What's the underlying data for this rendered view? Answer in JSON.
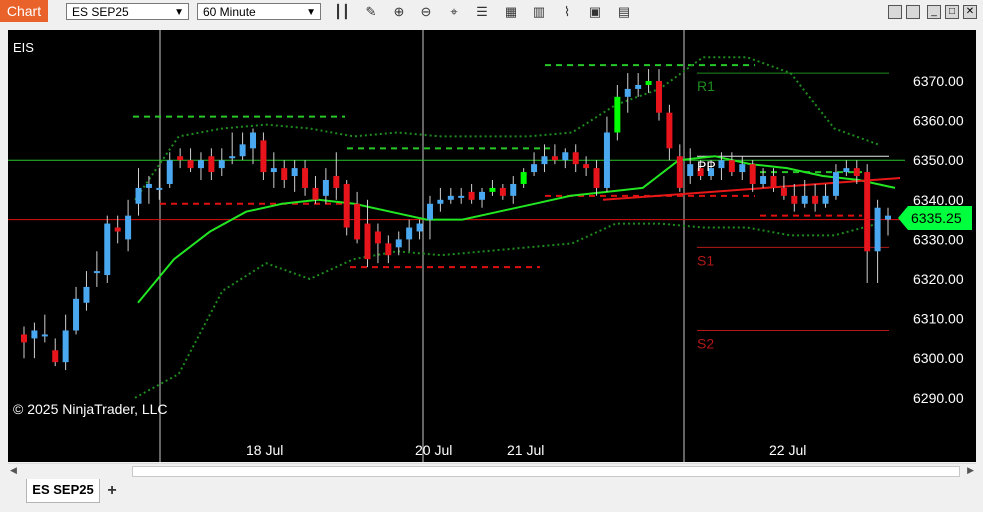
{
  "header": {
    "chart_tab": "Chart",
    "instrument_value": "ES SEP25",
    "interval_value": "60 Minute",
    "tools": [
      "bar-type-icon",
      "pencil-icon",
      "zoom-in-icon",
      "zoom-out-icon",
      "crosshair-icon",
      "properties-icon",
      "data-box-icon",
      "indicators-icon",
      "strategies-icon",
      "share-icon",
      "templates-icon"
    ],
    "window_buttons": [
      "minimize",
      "maximize",
      "close"
    ]
  },
  "chart": {
    "instrument_label": "EIS",
    "copyright": "© 2025 NinjaTrader, LLC",
    "current_price": "6335.25",
    "y_ticks": [
      "6370.00",
      "6360.00",
      "6350.00",
      "6340.00",
      "6330.00",
      "6320.00",
      "6310.00",
      "6300.00",
      "6290.00"
    ],
    "x_ticks": [
      "18 Jul",
      "20 Jul",
      "21 Jul",
      "22 Jul"
    ],
    "pivot_labels": {
      "r1": "R1",
      "pp": "PP",
      "s1": "S1",
      "s2": "S2"
    },
    "colors": {
      "up": "#4aa8f0",
      "down": "#e8141c",
      "up_green": "#00ff00",
      "pivot_green": "#1e8c1e",
      "pivot_red": "#b41818",
      "ma": "#22e622",
      "band": "#1e8c1e"
    }
  },
  "footer": {
    "tab_label": "ES SEP25",
    "add_tab": "+"
  },
  "chart_data": {
    "type": "candlestick",
    "y_ticks": [
      6290,
      6300,
      6310,
      6320,
      6330,
      6340,
      6350,
      6360,
      6370
    ],
    "ylim": [
      6286,
      6376
    ],
    "x_labels": [
      "18 Jul",
      "20 Jul",
      "21 Jul",
      "22 Jul"
    ],
    "last_price": 6335.25,
    "levels": {
      "R1": 6372,
      "PP": 6351,
      "S1": 6328,
      "S2": 6307
    },
    "candles": [
      [
        6306,
        6304,
        6308,
        6300
      ],
      [
        6305,
        6307,
        6309,
        6300
      ],
      [
        6306,
        6306,
        6311,
        6304
      ],
      [
        6302,
        6299,
        6305,
        6298
      ],
      [
        6299,
        6307,
        6311,
        6297
      ],
      [
        6307,
        6315,
        6318,
        6306
      ],
      [
        6314,
        6318,
        6322,
        6312
      ],
      [
        6322,
        6322,
        6327,
        6318
      ],
      [
        6321,
        6334,
        6336,
        6319
      ],
      [
        6333,
        6332,
        6336,
        6329
      ],
      [
        6330,
        6336,
        6340,
        6327
      ],
      [
        6339,
        6343,
        6348,
        6336
      ],
      [
        6343,
        6344,
        6346,
        6339
      ],
      [
        6343,
        6343,
        6348,
        6340
      ],
      [
        6344,
        6350,
        6352,
        6343
      ],
      [
        6351,
        6350,
        6353,
        6348
      ],
      [
        6350,
        6348,
        6353,
        6347
      ],
      [
        6348,
        6350,
        6352,
        6345
      ],
      [
        6351,
        6347,
        6353,
        6345
      ],
      [
        6348,
        6350,
        6353,
        6346
      ],
      [
        6351,
        6351,
        6357,
        6349
      ],
      [
        6351,
        6354,
        6357,
        6350
      ],
      [
        6353,
        6357,
        6358,
        6349
      ],
      [
        6355,
        6347,
        6357,
        6345
      ],
      [
        6347,
        6348,
        6352,
        6343
      ],
      [
        6348,
        6345,
        6350,
        6343
      ],
      [
        6346,
        6348,
        6350,
        6342
      ],
      [
        6348,
        6343,
        6350,
        6341
      ],
      [
        6343,
        6340,
        6346,
        6339
      ],
      [
        6341,
        6345,
        6348,
        6339
      ],
      [
        6346,
        6343,
        6352,
        6340
      ],
      [
        6344,
        6333,
        6345,
        6331
      ],
      [
        6339,
        6330,
        6342,
        6329
      ],
      [
        6334,
        6325,
        6340,
        6323
      ],
      [
        6332,
        6329,
        6334,
        6324
      ],
      [
        6329,
        6326,
        6331,
        6324
      ],
      [
        6328,
        6330,
        6332,
        6326
      ],
      [
        6330,
        6333,
        6335,
        6327
      ],
      [
        6332,
        6334,
        6335,
        6330
      ],
      [
        6335,
        6339,
        6341,
        6330
      ],
      [
        6339,
        6340,
        6343,
        6337
      ],
      [
        6340,
        6341,
        6343,
        6339
      ],
      [
        6341,
        6341,
        6343,
        6339
      ],
      [
        6342,
        6340,
        6344,
        6339
      ],
      [
        6340,
        6342,
        6343,
        6338
      ],
      [
        6342,
        6343,
        6345,
        6341
      ],
      [
        6343,
        6341,
        6344,
        6340
      ],
      [
        6341,
        6344,
        6346,
        6339
      ],
      [
        6344,
        6347,
        6348,
        6343
      ],
      [
        6347,
        6349,
        6352,
        6346
      ],
      [
        6349,
        6351,
        6354,
        6347
      ],
      [
        6351,
        6350,
        6354,
        6349
      ],
      [
        6350,
        6352,
        6353,
        6348
      ],
      [
        6352,
        6349,
        6354,
        6347
      ],
      [
        6349,
        6348,
        6351,
        6346
      ],
      [
        6348,
        6343,
        6350,
        6341
      ],
      [
        6343,
        6357,
        6361,
        6342
      ],
      [
        6357,
        6366,
        6369,
        6355
      ],
      [
        6366,
        6368,
        6372,
        6362
      ],
      [
        6368,
        6369,
        6372,
        6366
      ],
      [
        6369,
        6370,
        6373,
        6367
      ],
      [
        6370,
        6362,
        6373,
        6360
      ],
      [
        6362,
        6353,
        6364,
        6350
      ],
      [
        6351,
        6343,
        6354,
        6342
      ],
      [
        6346,
        6349,
        6353,
        6344
      ],
      [
        6348,
        6346,
        6350,
        6345
      ],
      [
        6346,
        6348,
        6350,
        6345
      ],
      [
        6348,
        6350,
        6352,
        6345
      ],
      [
        6350,
        6347,
        6352,
        6346
      ],
      [
        6347,
        6349,
        6351,
        6345
      ],
      [
        6349,
        6344,
        6350,
        6342
      ],
      [
        6344,
        6346,
        6348,
        6343
      ],
      [
        6346,
        6343,
        6348,
        6342
      ],
      [
        6343,
        6341,
        6346,
        6340
      ],
      [
        6341,
        6339,
        6344,
        6337
      ],
      [
        6339,
        6341,
        6345,
        6338
      ],
      [
        6341,
        6339,
        6344,
        6337
      ],
      [
        6339,
        6341,
        6344,
        6338
      ],
      [
        6341,
        6347,
        6349,
        6340
      ],
      [
        6347,
        6348,
        6350,
        6346
      ],
      [
        6348,
        6346,
        6350,
        6344
      ],
      [
        6347,
        6327,
        6349,
        6319
      ],
      [
        6327,
        6338,
        6340,
        6319
      ],
      [
        6335,
        6336,
        6338,
        6331
      ]
    ],
    "ma": [
      6314,
      6325,
      6332,
      6337,
      6339,
      6340,
      6339,
      6337,
      6335,
      6335,
      6337,
      6339,
      6341,
      6342,
      6343,
      6350,
      6351,
      6349,
      6348,
      6346,
      6345,
      6343
    ],
    "band_upper": [
      6340,
      6356,
      6358,
      6359,
      6358,
      6356,
      6357,
      6356,
      6356,
      6356,
      6357,
      6364,
      6368,
      6376,
      6376,
      6372,
      6358,
      6354
    ],
    "band_lower": [
      6290,
      6296,
      6317,
      6324,
      6320,
      6325,
      6327,
      6326,
      6327,
      6328,
      6329,
      6334,
      6334,
      6333,
      6333,
      6331,
      6331,
      6334
    ]
  }
}
